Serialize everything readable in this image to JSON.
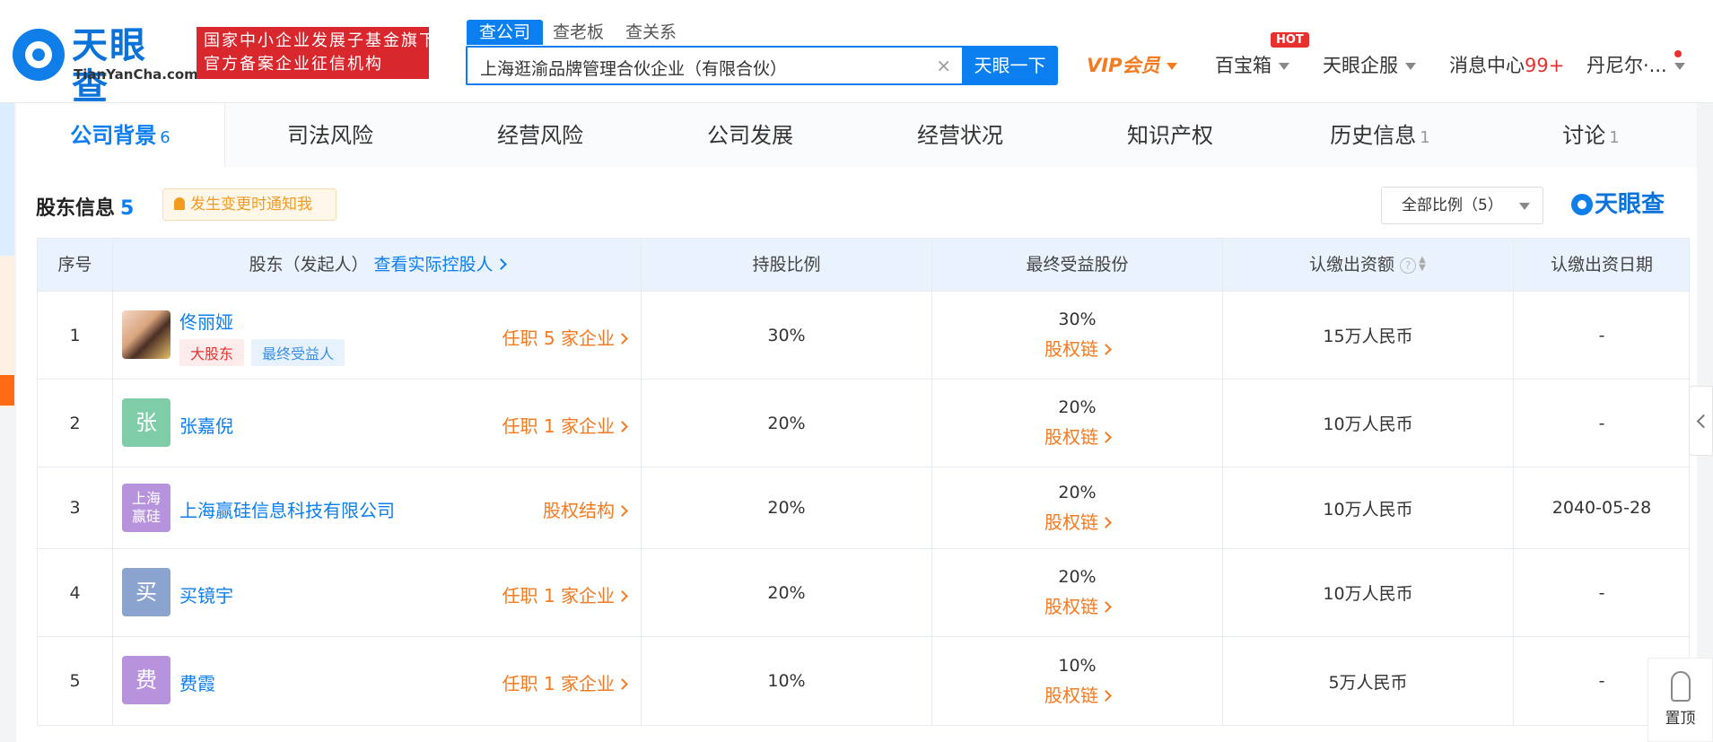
{
  "header": {
    "logo_cn": "天眼查",
    "logo_en": "TianYanCha.com",
    "slogan_line1": "国家中小企业发展子基金旗下",
    "slogan_line2": "官方备案企业征信机构",
    "search_tabs": [
      "查公司",
      "查老板",
      "查关系"
    ],
    "search_value": "上海逛渝品牌管理合伙企业（有限合伙）",
    "search_button": "天眼一下",
    "nav": {
      "vip": "VIP会员",
      "treasure": "百宝箱",
      "hot_badge": "HOT",
      "enterprise": "天眼企服",
      "messages": "消息中心",
      "messages_count": "99+",
      "user": "丹尼尔·..."
    }
  },
  "tabs": [
    {
      "label": "公司背景",
      "count": "6"
    },
    {
      "label": "司法风险",
      "count": ""
    },
    {
      "label": "经营风险",
      "count": ""
    },
    {
      "label": "公司发展",
      "count": ""
    },
    {
      "label": "经营状况",
      "count": ""
    },
    {
      "label": "知识产权",
      "count": ""
    },
    {
      "label": "历史信息",
      "count": "1"
    },
    {
      "label": "讨论",
      "count": "1"
    }
  ],
  "section": {
    "title": "股东信息",
    "count": "5",
    "notify": "发生变更时通知我",
    "ratio_select": "全部比例（5）",
    "watermark": "天眼查"
  },
  "table": {
    "headers": {
      "index": "序号",
      "shareholder": "股东（发起人）",
      "controller_link": "查看实际控股人",
      "ratio": "持股比例",
      "final_share": "最终受益股份",
      "subscribed": "认缴出资额",
      "date": "认缴出资日期"
    },
    "equity_chain_label": "股权链",
    "rows": [
      {
        "index": "1",
        "name": "佟丽娅",
        "avatar": "",
        "avatar_color": "#d9a47e",
        "tags": [
          "大股东",
          "最终受益人"
        ],
        "link": "任职 5 家企业",
        "ratio": "30%",
        "final_share": "30%",
        "subscribed": "15万人民币",
        "date": "-"
      },
      {
        "index": "2",
        "name": "张嘉倪",
        "avatar": "张",
        "avatar_color": "#7fcca8",
        "tags": [],
        "link": "任职 1 家企业",
        "ratio": "20%",
        "final_share": "20%",
        "subscribed": "10万人民币",
        "date": "-"
      },
      {
        "index": "3",
        "name": "上海赢硅信息科技有限公司",
        "avatar": "上海赢硅",
        "avatar_color": "#b793de",
        "tags": [],
        "link": "股权结构",
        "ratio": "20%",
        "final_share": "20%",
        "subscribed": "10万人民币",
        "date": "2040-05-28"
      },
      {
        "index": "4",
        "name": "买镜宇",
        "avatar": "买",
        "avatar_color": "#8ba3cf",
        "tags": [],
        "link": "任职 1 家企业",
        "ratio": "20%",
        "final_share": "20%",
        "subscribed": "10万人民币",
        "date": "-"
      },
      {
        "index": "5",
        "name": "费霞",
        "avatar": "费",
        "avatar_color": "#b793de",
        "tags": [],
        "link": "任职 1 家企业",
        "ratio": "10%",
        "final_share": "10%",
        "subscribed": "5万人民币",
        "date": "-"
      }
    ]
  },
  "side": {
    "top_label": "置顶"
  }
}
